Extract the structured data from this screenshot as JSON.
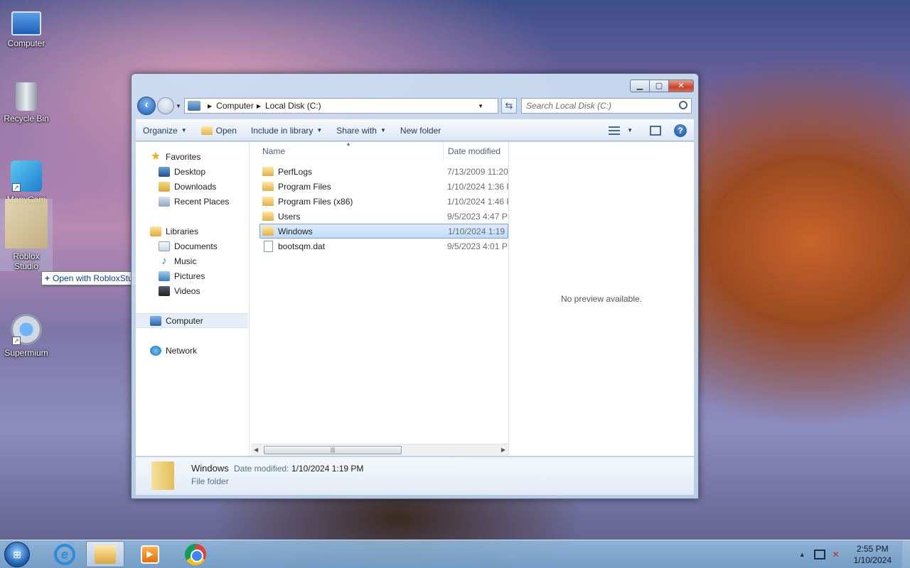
{
  "desktop": {
    "icons": [
      {
        "label": "Computer",
        "icon": "computer-icon"
      },
      {
        "label": "Recycle Bin",
        "icon": "recycle-bin-icon"
      },
      {
        "label": "ManyCam",
        "icon": "manycam-icon"
      },
      {
        "label": "Roblox Studio",
        "icon": "roblox-studio-icon"
      },
      {
        "label": "Supermium",
        "icon": "supermium-icon"
      }
    ],
    "drag_tooltip": "Open with RobloxStudio"
  },
  "window": {
    "address": {
      "crumbs": [
        "Computer",
        "Local Disk (C:)"
      ]
    },
    "search": {
      "placeholder": "Search Local Disk (C:)"
    },
    "toolbar": {
      "organize": "Organize",
      "open": "Open",
      "include_in_library": "Include in library",
      "share_with": "Share with",
      "new_folder": "New folder"
    },
    "nav_pane": {
      "favorites": {
        "label": "Favorites",
        "items": [
          "Desktop",
          "Downloads",
          "Recent Places"
        ]
      },
      "libraries": {
        "label": "Libraries",
        "items": [
          "Documents",
          "Music",
          "Pictures",
          "Videos"
        ]
      },
      "computer": "Computer",
      "network": "Network"
    },
    "columns": {
      "name": "Name",
      "date_modified": "Date modified"
    },
    "files": [
      {
        "name": "PerfLogs",
        "date": "7/13/2009 11:20",
        "type": "folder"
      },
      {
        "name": "Program Files",
        "date": "1/10/2024 1:36 P",
        "type": "folder"
      },
      {
        "name": "Program Files (x86)",
        "date": "1/10/2024 1:46 P",
        "type": "folder"
      },
      {
        "name": "Users",
        "date": "9/5/2023 4:47 PI",
        "type": "folder"
      },
      {
        "name": "Windows",
        "date": "1/10/2024 1:19 P",
        "type": "folder",
        "selected": true
      },
      {
        "name": "bootsqm.dat",
        "date": "9/5/2023 4:01 PI",
        "type": "file"
      }
    ],
    "preview_text": "No preview available.",
    "details": {
      "name": "Windows",
      "date_label": "Date modified:",
      "date_value": "1/10/2024 1:19 PM",
      "type": "File folder"
    }
  },
  "taskbar": {
    "apps": [
      "internet-explorer-icon",
      "windows-explorer-icon",
      "media-player-icon",
      "chrome-icon"
    ],
    "clock": {
      "time": "2:55 PM",
      "date": "1/10/2024"
    }
  }
}
